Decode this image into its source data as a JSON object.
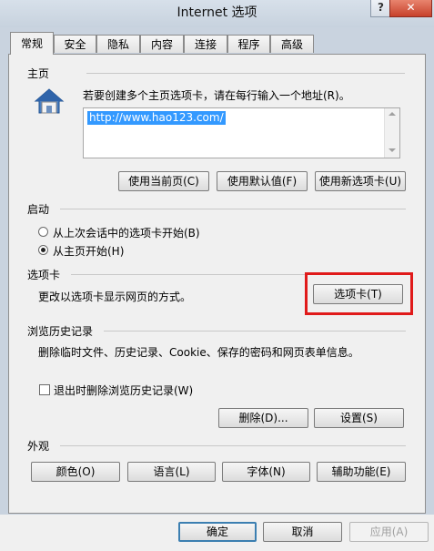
{
  "window": {
    "title": "Internet 选项",
    "help_glyph": "?",
    "close_glyph": "✕"
  },
  "tabs": [
    {
      "label": "常规",
      "active": true
    },
    {
      "label": "安全"
    },
    {
      "label": "隐私"
    },
    {
      "label": "内容"
    },
    {
      "label": "连接"
    },
    {
      "label": "程序"
    },
    {
      "label": "高级"
    }
  ],
  "homepage": {
    "section_title": "主页",
    "instruction": "若要创建多个主页选项卡，请在每行输入一个地址(R)。",
    "url": "http://www.hao123.com/",
    "buttons": {
      "use_current": "使用当前页(C)",
      "use_default": "使用默认值(F)",
      "use_new_tab": "使用新选项卡(U)"
    }
  },
  "startup": {
    "section_title": "启动",
    "option_last_session": "从上次会话中的选项卡开始(B)",
    "option_home_page": "从主页开始(H)",
    "selected": "option_home_page"
  },
  "tabs_section": {
    "section_title": "选项卡",
    "description": "更改以选项卡显示网页的方式。",
    "button": "选项卡(T)"
  },
  "history": {
    "section_title": "浏览历史记录",
    "description": "删除临时文件、历史记录、Cookie、保存的密码和网页表单信息。",
    "checkbox_label": "退出时删除浏览历史记录(W)",
    "checkbox_checked": false,
    "delete_button": "删除(D)...",
    "settings_button": "设置(S)"
  },
  "appearance": {
    "section_title": "外观",
    "colors_button": "颜色(O)",
    "languages_button": "语言(L)",
    "fonts_button": "字体(N)",
    "accessibility_button": "辅助功能(E)"
  },
  "footer": {
    "ok": "确定",
    "cancel": "取消",
    "apply": "应用(A)"
  },
  "colors": {
    "highlight_box": "#e01a1a",
    "selection": "#3399ff",
    "close_button": "#c7412b"
  }
}
